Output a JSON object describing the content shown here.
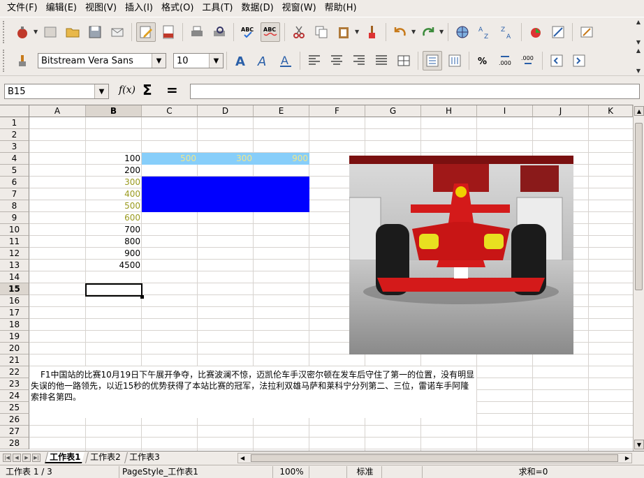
{
  "menu": [
    "文件(F)",
    "编辑(E)",
    "视图(V)",
    "插入(I)",
    "格式(O)",
    "工具(T)",
    "数据(D)",
    "视窗(W)",
    "帮助(H)"
  ],
  "formatting": {
    "font_name": "Bitstream Vera Sans",
    "font_size": "10"
  },
  "formula_bar": {
    "cell_ref": "B15",
    "fx_label": "f(x)",
    "sum_label": "Σ",
    "equals_label": "=",
    "value": ""
  },
  "columns": [
    "A",
    "B",
    "C",
    "D",
    "E",
    "F",
    "G",
    "H",
    "I",
    "J",
    "K"
  ],
  "rows": [
    "1",
    "2",
    "3",
    "4",
    "5",
    "6",
    "7",
    "8",
    "9",
    "10",
    "11",
    "12",
    "13",
    "14",
    "15",
    "16",
    "17",
    "18",
    "19",
    "20",
    "21",
    "22",
    "23",
    "24",
    "25",
    "26",
    "27",
    "28"
  ],
  "selected": {
    "column": "B",
    "row": "15"
  },
  "cells": {
    "b4": "100",
    "b5": "200",
    "b6": "300",
    "b7": "400",
    "b8": "500",
    "b9": "600",
    "b10": "700",
    "b11": "800",
    "b12": "900",
    "b13": "4500",
    "c4": "500",
    "d4": "300",
    "e4": "900"
  },
  "colors": {
    "light_blue_fill": "#87cefa",
    "blue_fill": "#0000ff",
    "olive_text": "#9a9a1e",
    "yellow_text": "#f0e68c"
  },
  "textbox": "F1中国站的比赛10月19日下午展开争夺，比赛波澜不惊，迈凯伦车手汉密尔顿在发车后守住了第一的位置，没有明显失误的他一路领先，以近15秒的优势获得了本站比赛的冠军，法拉利双雄马萨和莱科宁分列第二、三位，雷诺车手阿隆索排名第四。",
  "sheet_tabs": [
    "工作表1",
    "工作表2",
    "工作表3"
  ],
  "status": {
    "sheet": "工作表 1 / 3",
    "page_style": "PageStyle_工作表1",
    "zoom": "100%",
    "mode": "标准",
    "sum": "求和=0"
  }
}
